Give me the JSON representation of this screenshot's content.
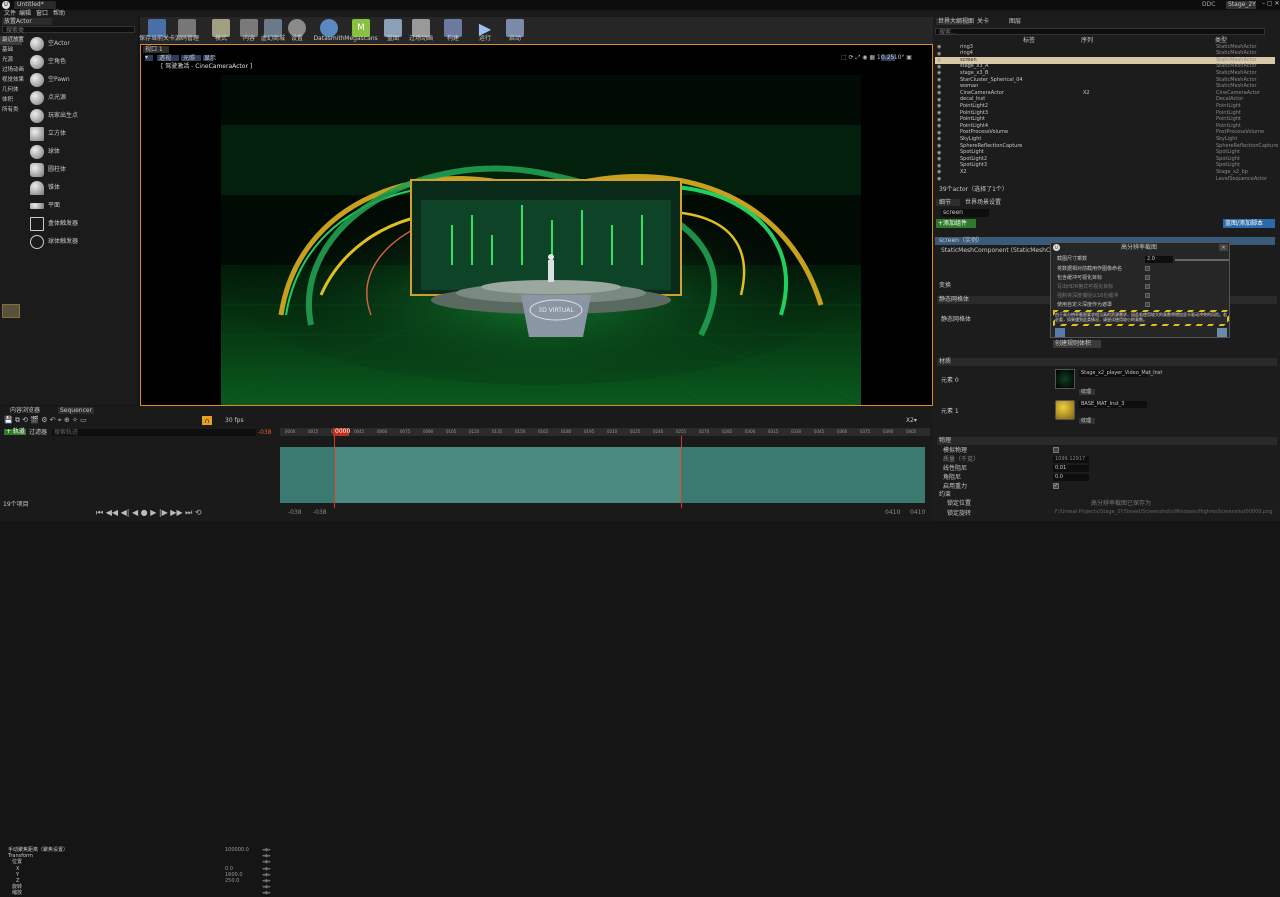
{
  "titlebar": {
    "tab": "Untitled*",
    "window_title": "Stage_2Y",
    "ddc": "DDC",
    "menu": [
      "文件",
      "编辑",
      "窗口",
      "帮助"
    ]
  },
  "place_panel": {
    "tab": "放置Actor",
    "search_placeholder": "搜索类",
    "categories": [
      "最近放置",
      "基础",
      "光源",
      "过场动画",
      "视觉效果",
      "几何体",
      "体积",
      "所有类"
    ],
    "items": [
      "空Actor",
      "空角色",
      "空Pawn",
      "点光源",
      "玩家出生点",
      "立方体",
      "球体",
      "圆柱体",
      "锥体",
      "平面",
      "盒体触发器",
      "球体触发器"
    ]
  },
  "toolbar": {
    "buttons": [
      "保存当前关卡",
      "源码管理",
      "模式",
      "内容",
      "虚幻商城",
      "设置",
      "Datasmith",
      "Megascans",
      "蓝图",
      "过场动画",
      "构建",
      "运行",
      "启动"
    ]
  },
  "viewport": {
    "tab": "视口 1",
    "perspective": "透视",
    "lit": "光照",
    "show": "显示",
    "pilot_label": "[ 驾驶激活 - CineCameraActor ]",
    "speed": "0.25",
    "podium_text": "3D VIRTUAL"
  },
  "outliner": {
    "tabs": [
      "世界大纲视图",
      "关卡",
      "图层"
    ],
    "search_placeholder": "搜索...",
    "col_label": "标签",
    "col_seq": "序列",
    "col_type": "类型",
    "rows": [
      {
        "name": "ring3",
        "type": "StaticMeshActor"
      },
      {
        "name": "ring4",
        "type": "StaticMeshActor"
      },
      {
        "name": "screen",
        "type": "StaticMeshActor"
      },
      {
        "name": "stage_x3_A",
        "type": "StaticMeshActor"
      },
      {
        "name": "stage_x3_B",
        "type": "StaticMeshActor"
      },
      {
        "name": "StarCluster_Spherical_04",
        "type": "StaticMeshActor"
      },
      {
        "name": "woman",
        "type": "StaticMeshActor"
      },
      {
        "name": "CineCameraActor",
        "type": "CineCameraActor",
        "seq": "X2"
      },
      {
        "name": "decal_Inst",
        "type": "DecalActor"
      },
      {
        "name": "PointLight2",
        "type": "PointLight"
      },
      {
        "name": "PointLight3",
        "type": "PointLight"
      },
      {
        "name": "PointLight",
        "type": "PointLight"
      },
      {
        "name": "PointLight4",
        "type": "PointLight"
      },
      {
        "name": "PostProcessVolume",
        "type": "PostProcessVolume"
      },
      {
        "name": "SkyLight",
        "type": "SkyLight"
      },
      {
        "name": "SphereReflectionCapture",
        "type": "SphereReflectionCapture"
      },
      {
        "name": "SpotLight",
        "type": "SpotLight"
      },
      {
        "name": "SpotLight2",
        "type": "SpotLight"
      },
      {
        "name": "SpotLight3",
        "type": "SpotLight"
      },
      {
        "name": "X2",
        "type": "Stage_x2_bp"
      },
      {
        "name": "",
        "type": "LevelSequenceActor"
      }
    ],
    "status": "39个actor（选择了1个）"
  },
  "details": {
    "tabs": [
      "细节",
      "世界场景设置"
    ],
    "name_value": "screen",
    "add_component": "+添加组件",
    "blueprint_btn": "蓝图/添加脚本",
    "selected": "screen（实例）",
    "component": "StaticMeshComponent (StaticMeshComponent0) (继承)",
    "sections": {
      "transform": "变换",
      "static_mesh": "静态网格体",
      "static_mesh_label": "静态网格体",
      "lod": "创建规则体积",
      "materials": "材质",
      "mat0_label": "元素 0",
      "mat0": "Stage_x2_player_Video_Mat_Inst",
      "mat1_label": "元素 1",
      "mat1": "BASE_MAT_Inst_3",
      "mat_btn": "纹理",
      "physics": "物理",
      "sim": "模拟物理",
      "mass": "质量（千克）",
      "mass_value": "1099.12917",
      "lin": "线性阻尼",
      "lin_value": "0.01",
      "ang": "角阻尼",
      "ang_value": "0.0",
      "grav": "启用重力",
      "lock": "约束",
      "lock_pos": "锁定位置",
      "lock_rot": "锁定旋转"
    }
  },
  "dialog": {
    "title": "高分辨率截图",
    "rows": [
      "截图尺寸乘数",
      "将数据相对前截用作图像命名",
      "包含缓冲可视化目标",
      "写出HDR格式可视化目标",
      "强制将深度捕捉以16位缓冲",
      "使用自定义深度作为遮罩"
    ],
    "multiplier": "2.0",
    "warning": "由于高分辨率截图要求相当高的资源需求，因此若使用较大的乘数将增加显卡驱动冲突的风险。若必要，如果遇到此类情况，请尝试使用较小的乘数。"
  },
  "sequencer": {
    "tabs": [
      "内容浏览器",
      "Sequencer"
    ],
    "fps": "30 fps",
    "filter": "过滤器",
    "search_placeholder": "搜索轨迹",
    "tracks": [
      "手动聚焦距离（聚焦设置）",
      "Transform",
      "位置",
      "X",
      "Y",
      "Z",
      "旋转",
      "缩放"
    ],
    "values": [
      "100000.0",
      "",
      "",
      "0.0",
      "1600.0",
      "250.0",
      "",
      ""
    ],
    "track_name": "X2▾",
    "playhead": "0000",
    "start": "-038",
    "start2": "-038",
    "end": "0410",
    "end2": "0410",
    "status": "19个项目",
    "ticks": [
      "0000",
      "0015",
      "0030",
      "0045",
      "0060",
      "0075",
      "0090",
      "0105",
      "0120",
      "0135",
      "0150",
      "0165",
      "0180",
      "0195",
      "0210",
      "0225",
      "0240",
      "0255",
      "0270",
      "0285",
      "0300",
      "0315",
      "0330",
      "0345",
      "0360",
      "0375",
      "0390",
      "0405"
    ]
  },
  "watermark": {
    "line1": "高分辨率截图已保存为",
    "line2": "F:/Unreal Projects/Stage_2Y/Saved/Screenshots/Windows/HighresScreenshot00000.png"
  },
  "colors": {
    "accent": "#e8a020",
    "green": "#20e070",
    "selection": "#d8c8a8"
  }
}
